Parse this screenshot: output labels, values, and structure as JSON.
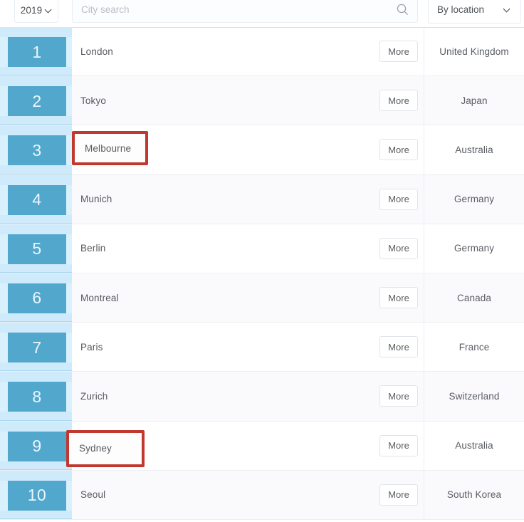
{
  "toolbar": {
    "year_select": {
      "value": "2019",
      "chevron_icon": "chevron-down-icon"
    },
    "search": {
      "value": "",
      "placeholder": "City search",
      "icon": "search-icon"
    },
    "location_select": {
      "value": "By location",
      "chevron_icon": "chevron-down-icon"
    }
  },
  "table": {
    "more_label": "More",
    "rows": [
      {
        "rank": "1",
        "city": "London",
        "country": "United Kingdom",
        "highlighted": false
      },
      {
        "rank": "2",
        "city": "Tokyo",
        "country": "Japan",
        "highlighted": false
      },
      {
        "rank": "3",
        "city": "Melbourne",
        "country": "Australia",
        "highlighted": true
      },
      {
        "rank": "4",
        "city": "Munich",
        "country": "Germany",
        "highlighted": false
      },
      {
        "rank": "5",
        "city": "Berlin",
        "country": "Germany",
        "highlighted": false
      },
      {
        "rank": "6",
        "city": "Montreal",
        "country": "Canada",
        "highlighted": false
      },
      {
        "rank": "7",
        "city": "Paris",
        "country": "France",
        "highlighted": false
      },
      {
        "rank": "8",
        "city": "Zurich",
        "country": "Switzerland",
        "highlighted": false
      },
      {
        "rank": "9",
        "city": "Sydney",
        "country": "Australia",
        "highlighted": true
      },
      {
        "rank": "10",
        "city": "Seoul",
        "country": "South Korea",
        "highlighted": false
      }
    ]
  },
  "colors": {
    "rank_chip": "#52a7cd",
    "rank_column_bg": "#cfeafb",
    "rank_band_bg": "#d9f0fd",
    "highlight_border": "#c0382e",
    "row_alt_bg": "#fafafd",
    "text": "#56595e"
  }
}
